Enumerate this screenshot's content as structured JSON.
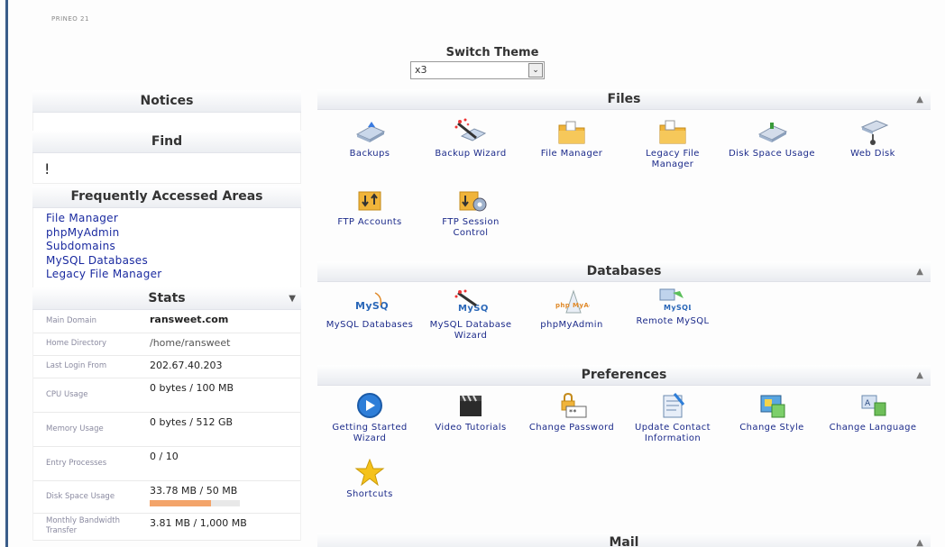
{
  "top_tiny": "PRINEO 21",
  "theme": {
    "title": "Switch Theme",
    "selected": "x3",
    "arrow": "⌄"
  },
  "notices": {
    "title": "Notices"
  },
  "find": {
    "title": "Find",
    "value": "!"
  },
  "faa": {
    "title": "Frequently Accessed Areas",
    "links": [
      "File Manager",
      "phpMyAdmin",
      "Subdomains",
      "MySQL Databases",
      "Legacy File Manager"
    ]
  },
  "stats": {
    "title": "Stats",
    "arrow": "▼",
    "rows": [
      {
        "label": "Main Domain",
        "value": "ransweet.com"
      },
      {
        "label": "Home Directory",
        "value": "/home/ransweet"
      },
      {
        "label": "Last Login From",
        "value": "202.67.40.203"
      },
      {
        "label": "CPU Usage",
        "value": "0 bytes / 100 MB"
      },
      {
        "label": "Memory Usage",
        "value": "0 bytes / 512 GB"
      },
      {
        "label": "Entry Processes",
        "value": "0 / 10"
      },
      {
        "label": "Disk Space Usage",
        "value": "33.78 MB / 50 MB",
        "fill": 0.68
      },
      {
        "label": "Monthly Bandwidth Transfer",
        "value": "3.81 MB / 1,000 MB"
      }
    ]
  },
  "files": {
    "title": "Files",
    "arrow": "▲",
    "items": [
      "Backups",
      "Backup Wizard",
      "File Manager",
      "Legacy File Manager",
      "Disk Space Usage",
      "Web Disk",
      "FTP Accounts",
      "FTP Session Control"
    ]
  },
  "databases": {
    "title": "Databases",
    "arrow": "▲",
    "items": [
      "MySQL Databases",
      "MySQL Database Wizard",
      "phpMyAdmin",
      "Remote MySQL"
    ],
    "mysql_logo": "MySQL",
    "pma_logo": "php MyAdmin"
  },
  "preferences": {
    "title": "Preferences",
    "arrow": "▲",
    "items": [
      "Getting Started Wizard",
      "Video Tutorials",
      "Change Password",
      "Update Contact Information",
      "Change Style",
      "Change Language",
      "Shortcuts"
    ]
  },
  "mail": {
    "title": "Mail",
    "arrow": "▲"
  },
  "colors": {
    "link": "#1a2aa0",
    "disk_bar": "#f3a46a",
    "folder": "#f0b43a"
  }
}
